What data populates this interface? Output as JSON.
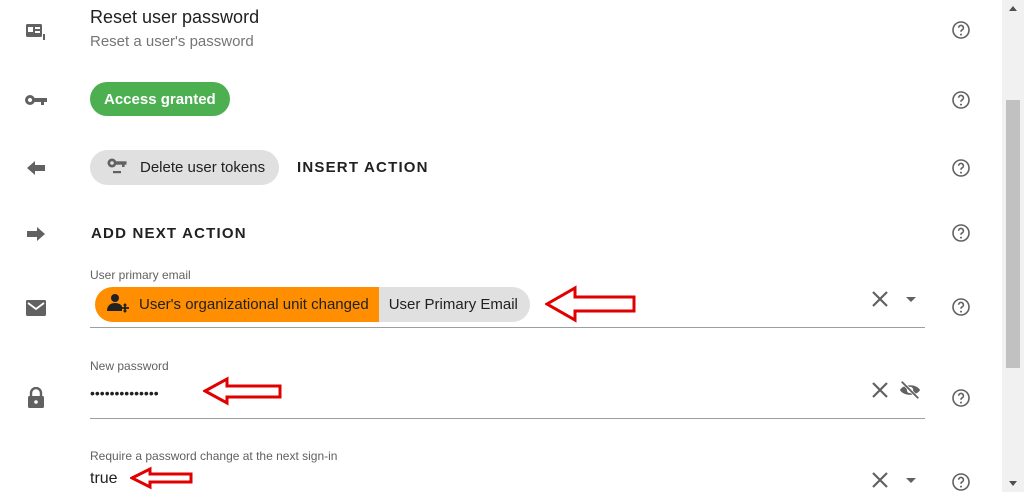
{
  "reset": {
    "title": "Reset user password",
    "subtitle": "Reset a user's password"
  },
  "access": {
    "label": "Access granted",
    "color": "#4caf50"
  },
  "tokens": {
    "chip_label": "Delete user tokens",
    "insert_label": "INSERT ACTION"
  },
  "next": {
    "label": "ADD NEXT ACTION"
  },
  "email_field": {
    "label": "User primary email",
    "chip_trigger": "User's organizational unit changed",
    "chip_value": "User Primary Email",
    "trigger_color": "#ff8f00"
  },
  "password_field": {
    "label": "New password",
    "value": "••••••••••••••"
  },
  "require_field": {
    "label": "Require a password change at the next sign-in",
    "value": "true"
  }
}
